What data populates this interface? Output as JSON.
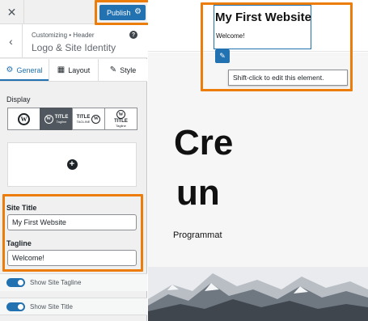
{
  "topbar": {
    "close_glyph": "✕",
    "publish_label": "Publish",
    "publish_icon": "gear-icon"
  },
  "section": {
    "breadcrumb": "Customizing • Header",
    "title": "Logo & Site Identity",
    "help_glyph": "?"
  },
  "tabs": [
    {
      "label": "General",
      "icon": "gear-icon",
      "active": true
    },
    {
      "label": "Layout",
      "icon": "layout-icon",
      "active": false
    },
    {
      "label": "Style",
      "icon": "brush-icon",
      "active": false
    }
  ],
  "display": {
    "label": "Display",
    "options": [
      {
        "name": "logo-only",
        "mini_title": "",
        "mini_tagline": ""
      },
      {
        "name": "logo-title-tagline",
        "mini_title": "TITLE",
        "mini_tagline": "Tagline",
        "active": true
      },
      {
        "name": "title-tagline-logo",
        "mini_title": "TITLE",
        "mini_tagline": "TAGLINE"
      },
      {
        "name": "logo-stacked-title",
        "mini_title": "TITLE",
        "mini_tagline": "Tagline"
      }
    ]
  },
  "fields": {
    "site_title_label": "Site Title",
    "site_title_value": "My First Website",
    "tagline_label": "Tagline",
    "tagline_value": "Welcome!"
  },
  "toggles": {
    "show_tagline": "Show Site Tagline",
    "show_title": "Show Site Title"
  },
  "preview": {
    "site_title": "My First Website",
    "tagline": "Welcome!",
    "edit_tip": "Shift-click to edit this element.",
    "hero_line1": "Cre",
    "hero_line2": "un",
    "hero_sub": "Programmat"
  },
  "colors": {
    "accent": "#2271b1",
    "highlight": "#ed7d0a",
    "panel": "#f0f0f1"
  }
}
